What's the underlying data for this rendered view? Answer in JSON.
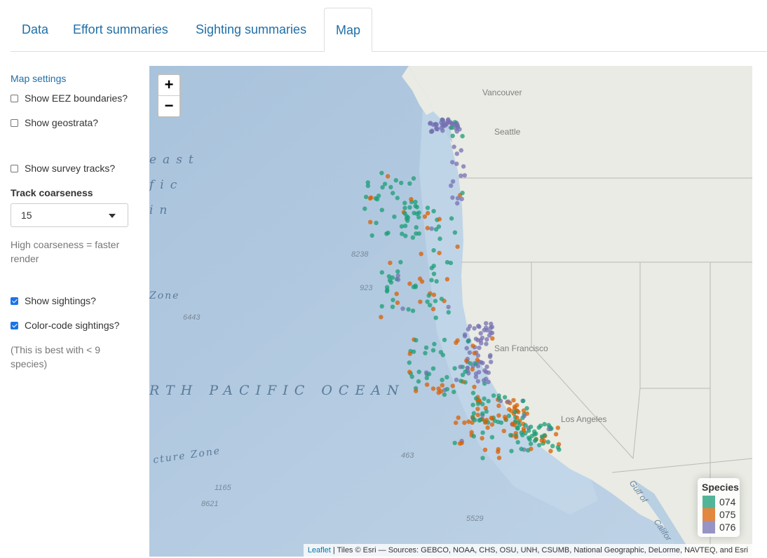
{
  "tabs": [
    {
      "label": "Data",
      "active": false
    },
    {
      "label": "Effort summaries",
      "active": false
    },
    {
      "label": "Sighting summaries",
      "active": false
    },
    {
      "label": "Map",
      "active": true
    }
  ],
  "sidebar": {
    "title": "Map settings",
    "show_eez": {
      "label": "Show EEZ boundaries?",
      "checked": false
    },
    "show_geostrata": {
      "label": "Show geostrata?",
      "checked": false
    },
    "show_tracks": {
      "label": "Show survey tracks?",
      "checked": false
    },
    "track_coarseness_label": "Track coarseness",
    "track_coarseness_value": "15",
    "coarseness_help": "High coarseness = faster render",
    "show_sightings": {
      "label": "Show sightings?",
      "checked": true
    },
    "color_code": {
      "label": "Color-code sightings?",
      "checked": true
    },
    "color_help": "(This is best with < 9 species)"
  },
  "map": {
    "zoom_in": "+",
    "zoom_out": "−",
    "cities": [
      "Vancouver",
      "Seattle",
      "San Francisco",
      "Los Angeles"
    ],
    "ocean_label": "RTH PACIFIC OCEAN",
    "ocean_fragments": [
      "east",
      "fic",
      "in"
    ],
    "zone_labels": [
      "Zone",
      "cture Zone"
    ],
    "depth_labels": [
      "8238",
      "923",
      "6443",
      "463",
      "1165",
      "8621",
      "5529"
    ],
    "gulf_label": "Gulf of",
    "gulf_label_2": "Califor",
    "attribution_link": "Leaflet",
    "attribution_text": " | Tiles © Esri — Sources: GEBCO, NOAA, CHS, OSU, UNH, CSUMB, National Geographic, DeLorme, NAVTEQ, and Esri",
    "legend": {
      "title": "Species",
      "items": [
        {
          "label": "074",
          "color": "#1b9e77"
        },
        {
          "label": "075",
          "color": "#d95f02"
        },
        {
          "label": "076",
          "color": "#7570b3"
        }
      ]
    }
  }
}
